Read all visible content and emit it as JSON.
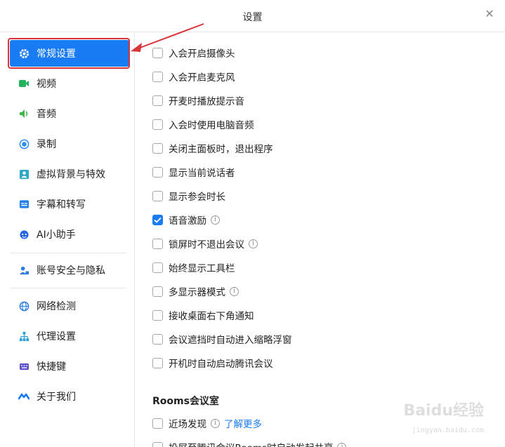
{
  "window": {
    "title": "设置"
  },
  "sidebar": {
    "items": [
      {
        "label": "常规设置",
        "icon": "gear-icon",
        "active": true
      },
      {
        "label": "视频",
        "icon": "video-icon"
      },
      {
        "label": "音频",
        "icon": "speaker-icon"
      },
      {
        "label": "录制",
        "icon": "record-icon"
      },
      {
        "label": "虚拟背景与特效",
        "icon": "portrait-icon"
      },
      {
        "label": "字幕和转写",
        "icon": "caption-icon"
      },
      {
        "label": "AI小助手",
        "icon": "robot-icon"
      },
      {
        "label": "账号安全与隐私",
        "icon": "user-lock-icon"
      },
      {
        "label": "网络检测",
        "icon": "globe-icon"
      },
      {
        "label": "代理设置",
        "icon": "network-icon"
      },
      {
        "label": "快捷键",
        "icon": "keyboard-icon"
      },
      {
        "label": "关于我们",
        "icon": "logo-icon"
      }
    ]
  },
  "options": [
    {
      "label": "入会开启摄像头",
      "checked": false
    },
    {
      "label": "入会开启麦克风",
      "checked": false
    },
    {
      "label": "开麦时播放提示音",
      "checked": false
    },
    {
      "label": "入会时使用电脑音频",
      "checked": false
    },
    {
      "label": "关闭主面板时，退出程序",
      "checked": false
    },
    {
      "label": "显示当前说话者",
      "checked": false
    },
    {
      "label": "显示参会时长",
      "checked": false
    },
    {
      "label": "语音激励",
      "checked": true,
      "info": true
    },
    {
      "label": "锁屏时不退出会议",
      "checked": false,
      "info": true
    },
    {
      "label": "始终显示工具栏",
      "checked": false
    },
    {
      "label": "多显示器模式",
      "checked": false,
      "info": true
    },
    {
      "label": "接收桌面右下角通知",
      "checked": false
    },
    {
      "label": "会议遮挡时自动进入缩略浮窗",
      "checked": false
    },
    {
      "label": "开机时自动启动腾讯会议",
      "checked": false
    }
  ],
  "rooms": {
    "title": "Rooms会议室",
    "nearby_label": "近场发现",
    "learn_more": "了解更多",
    "cast_label": "投屏至腾讯会议Rooms时自动发起共享"
  },
  "watermark": {
    "brand": "Baidu经验",
    "url": "jingyan.baidu.com"
  },
  "colors": {
    "accent": "#1a7cf5",
    "highlight": "#d9343a"
  }
}
